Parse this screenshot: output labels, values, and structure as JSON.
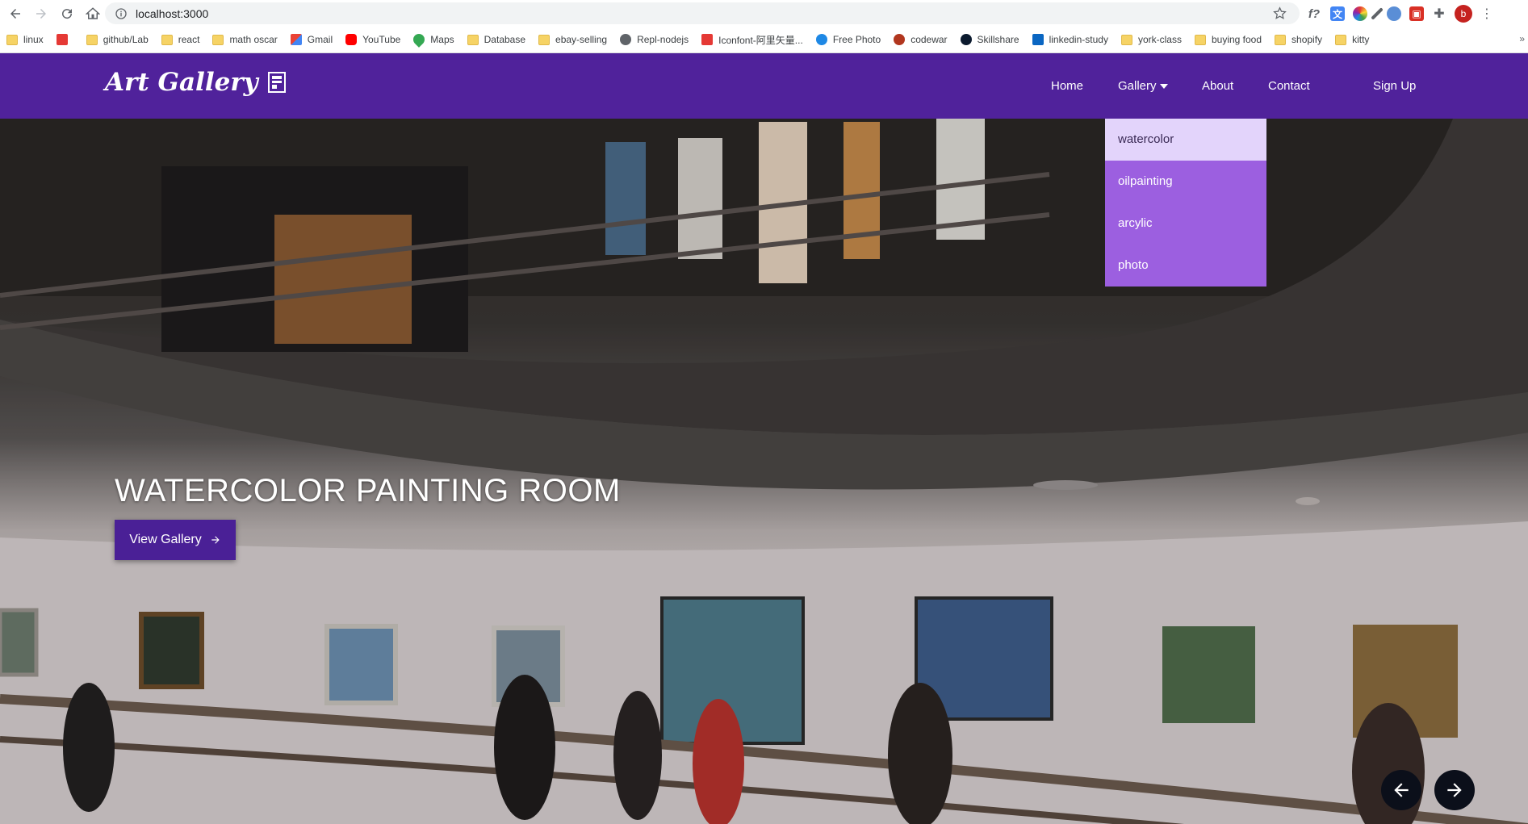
{
  "browser": {
    "url": "localhost:3000",
    "profile_initial": "b",
    "extensions": [
      "f?",
      "translate-icon",
      "color-wheel-icon",
      "eyedropper-icon",
      "privacy-icon",
      "capture-icon",
      "puzzle-icon"
    ],
    "bookmarks": [
      {
        "label": "linux",
        "icon": "folder-icon"
      },
      {
        "label": "",
        "icon": "app-icon"
      },
      {
        "label": "github/Lab",
        "icon": "folder-icon"
      },
      {
        "label": "react",
        "icon": "folder-icon"
      },
      {
        "label": "math oscar",
        "icon": "folder-icon"
      },
      {
        "label": "Gmail",
        "icon": "gmail-icon"
      },
      {
        "label": "YouTube",
        "icon": "youtube-icon"
      },
      {
        "label": "Maps",
        "icon": "maps-icon"
      },
      {
        "label": "Database",
        "icon": "folder-icon"
      },
      {
        "label": "ebay-selling",
        "icon": "folder-icon"
      },
      {
        "label": "Repl-nodejs",
        "icon": "repl-icon"
      },
      {
        "label": "Iconfont-阿里矢量...",
        "icon": "iconfont-icon"
      },
      {
        "label": "Free Photo",
        "icon": "photo-icon"
      },
      {
        "label": "codewar",
        "icon": "codewars-icon"
      },
      {
        "label": "Skillshare",
        "icon": "skillshare-icon"
      },
      {
        "label": "linkedin-study",
        "icon": "linkedin-icon"
      },
      {
        "label": "york-class",
        "icon": "folder-icon"
      },
      {
        "label": "buying food",
        "icon": "folder-icon"
      },
      {
        "label": "shopify",
        "icon": "folder-icon"
      },
      {
        "label": "kitty",
        "icon": "folder-icon"
      }
    ],
    "more_bookmarks": "»"
  },
  "site": {
    "brand": "Art Gallery",
    "nav": {
      "home": "Home",
      "gallery": "Gallery",
      "about": "About",
      "contact": "Contact",
      "signup": "Sign Up"
    },
    "gallery_menu": [
      "watercolor",
      "oilpainting",
      "arcylic",
      "photo"
    ],
    "hero": {
      "title": "WATERCOLOR PAINTING ROOM",
      "cta": "View Gallery"
    },
    "colors": {
      "navbar": "#50229b",
      "dropdown": "#9c5fe0",
      "dropdown_active": "#e3d4fb",
      "cta": "#4a2096"
    }
  }
}
